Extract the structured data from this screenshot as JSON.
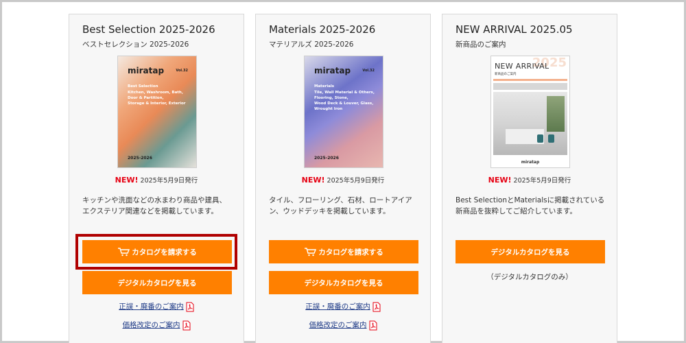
{
  "cards": [
    {
      "title": "Best Selection 2025-2026",
      "subtitle": "ベストセレクション 2025-2026",
      "cover": {
        "brand": "miratap",
        "vol": "Vol.32",
        "heading": "Best Selection",
        "items": "Kitchen, Washroom, Bath,\nDoor & Partition,\nStorage & Interior, Exterior",
        "year": "2025-2026"
      },
      "new_label": "NEW!",
      "release": "2025年5月9日発行",
      "description": "キッチンや洗面などの水まわり商品や建具、エクステリア関連などを掲載しています。",
      "request_button": "カタログを請求する",
      "digital_button": "デジタルカタログを見る",
      "links": [
        "正誤・廃番のご案内",
        "価格改定のご案内"
      ]
    },
    {
      "title": "Materials 2025-2026",
      "subtitle": "マテリアルズ 2025-2026",
      "cover": {
        "brand": "miratap",
        "vol": "Vol.32",
        "heading": "Materials",
        "items": "Tile, Wall Material & Others,\nFlooring, Stone,\nWood Deck & Louver, Glass,\nWrought Iron",
        "year": "2025-2026"
      },
      "new_label": "NEW!",
      "release": "2025年5月9日発行",
      "description": "タイル、フローリング、石材、ロートアイアン、ウッドデッキを掲載しています。",
      "request_button": "カタログを請求する",
      "digital_button": "デジタルカタログを見る",
      "links": [
        "正誤・廃番のご案内",
        "価格改定のご案内"
      ]
    },
    {
      "title": "NEW ARRIVAL 2025.05",
      "subtitle": "新商品のご案内",
      "cover": {
        "brand": "miratap",
        "year": "2025",
        "heading": "NEW ARRIVAL",
        "jp": "新商品のご案内"
      },
      "new_label": "NEW!",
      "release": "2025年5月9日発行",
      "description": "Best SelectionとMaterialsに掲載されている新商品を抜粋してご紹介しています。",
      "digital_button": "デジタルカタログを見る",
      "note": "（デジタルカタログのみ）"
    }
  ],
  "colors": {
    "accent": "#ff8000",
    "new": "#e60012",
    "link": "#1f3b87",
    "highlight": "#b00000"
  },
  "icons": {
    "cart": "cart-icon",
    "pdf": "pdf-icon"
  }
}
